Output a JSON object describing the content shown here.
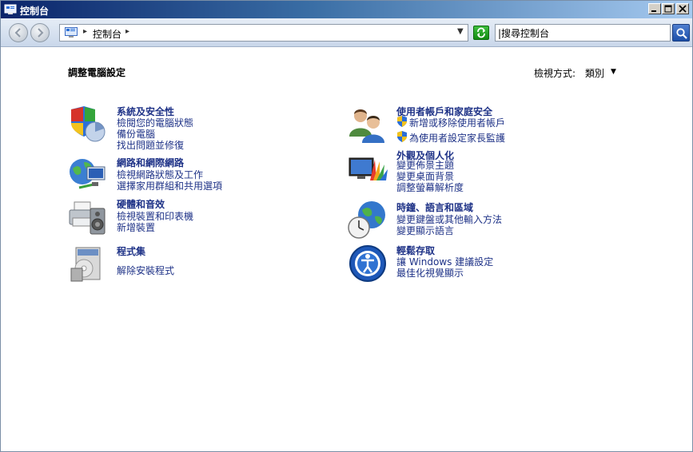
{
  "window": {
    "title": "控制台"
  },
  "address": {
    "path": "控制台"
  },
  "search": {
    "placeholder": "搜尋控制台",
    "value": "|搜尋控制台"
  },
  "content": {
    "heading": "調整電腦設定",
    "view_by_label": "檢視方式:",
    "view_by_value": "類別"
  },
  "categories": [
    {
      "title": "系統及安全性",
      "links": [
        "檢閱您的電腦狀態",
        "備份電腦",
        "找出問題並修復"
      ]
    },
    {
      "title": "網路和網際網路",
      "links": [
        "檢視網路狀態及工作",
        "選擇家用群組和共用選項"
      ]
    },
    {
      "title": "硬體和音效",
      "links": [
        "檢視裝置和印表機",
        "新增裝置"
      ]
    },
    {
      "title": "程式集",
      "links": [
        "解除安裝程式"
      ]
    },
    {
      "title": "使用者帳戶和家庭安全",
      "links": [
        "新增或移除使用者帳戶",
        "為使用者設定家長監護"
      ]
    },
    {
      "title": "外觀及個人化",
      "links": [
        "變更佈景主題",
        "變更桌面背景",
        "調整螢幕解析度"
      ]
    },
    {
      "title": "時鐘、語言和區域",
      "links": [
        "變更鍵盤或其他輸入方法",
        "變更顯示語言"
      ]
    },
    {
      "title": "輕鬆存取",
      "links": [
        "讓 Windows 建議設定",
        "最佳化視覺顯示"
      ]
    }
  ],
  "colors": {
    "link": "#1e3287",
    "title_bar": "#0a246a"
  }
}
